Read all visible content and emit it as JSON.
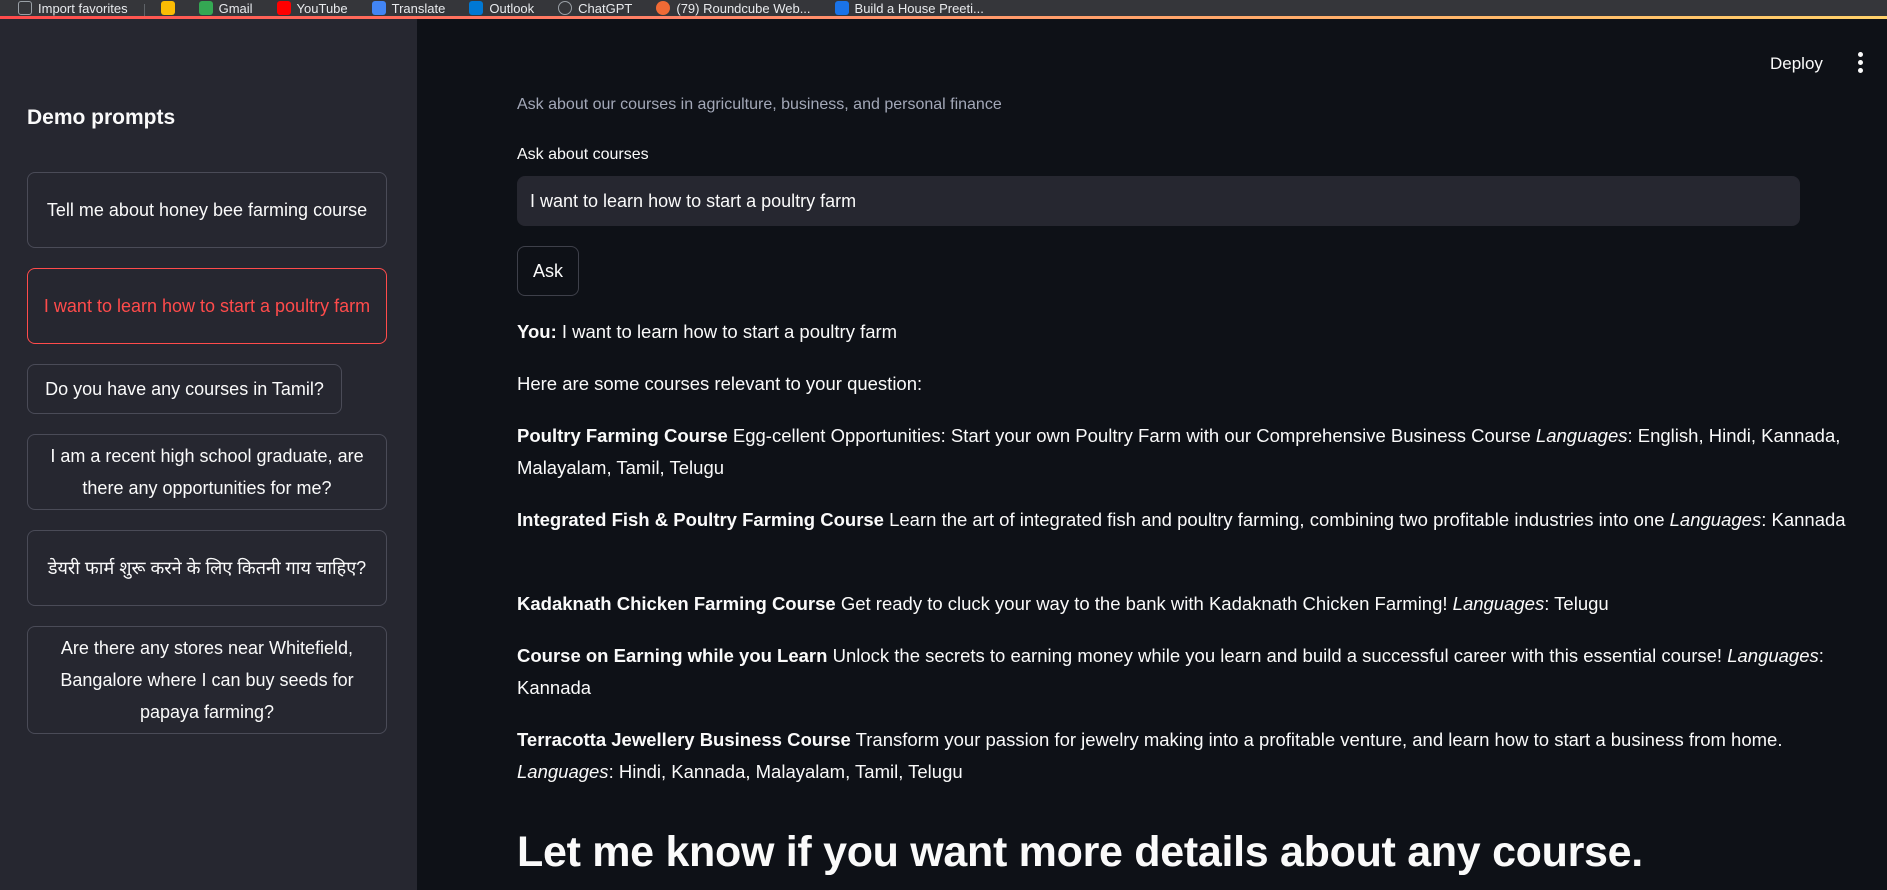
{
  "browser": {
    "bookmarks": [
      {
        "label": "Import favorites",
        "color": "#9aa0a6"
      },
      {
        "label": "",
        "color": "#fbbc04"
      },
      {
        "label": "Gmail",
        "color": "#34a853"
      },
      {
        "label": "YouTube",
        "color": "#ff0000"
      },
      {
        "label": "Translate",
        "color": "#4285f4"
      },
      {
        "label": "Outlook",
        "color": "#0078d4"
      },
      {
        "label": "ChatGPT",
        "color": "#9aa0a6"
      },
      {
        "label": "(79) Roundcube Web...",
        "color": "#f06a35"
      },
      {
        "label": "Build a House Preeti...",
        "color": "#1a73e8"
      }
    ]
  },
  "sidebar": {
    "title": "Demo prompts",
    "prompts": [
      {
        "label": "Tell me about honey bee farming course",
        "active": false
      },
      {
        "label": "I want to learn how to start a poultry farm",
        "active": true
      },
      {
        "label": "Do you have any courses in Tamil?",
        "active": false
      },
      {
        "label": "I am a recent high school graduate, are there any opportunities for me?",
        "active": false
      },
      {
        "label": "डेयरी फार्म शुरू करने के लिए कितनी गाय चाहिए?",
        "active": false
      },
      {
        "label": "Are there any stores near Whitefield, Bangalore where I can buy seeds for papaya farming?",
        "active": false
      }
    ]
  },
  "header": {
    "deploy_label": "Deploy"
  },
  "main": {
    "caption": "Ask about our courses in agriculture, business, and personal finance",
    "input_label": "Ask about courses",
    "input_value": "I want to learn how to start a poultry farm",
    "ask_label": "Ask",
    "you_label": "You:",
    "you_message": " I want to learn how to start a poultry farm",
    "intro": "Here are some courses relevant to your question:",
    "languages_label": "Languages",
    "courses": [
      {
        "name": "Poultry Farming Course",
        "description": " Egg-cellent Opportunities: Start your own Poultry Farm with our Comprehensive Business Course ",
        "languages": ": English, Hindi, Kannada, Malayalam, Tamil, Telugu"
      },
      {
        "name": "Integrated Fish & Poultry Farming Course",
        "description": " Learn the art of integrated fish and poultry farming, combining two profitable industries into one ",
        "languages": ": Kannada"
      },
      {
        "name": "Kadaknath Chicken Farming Course",
        "description": " Get ready to cluck your way to the bank with Kadaknath Chicken Farming! ",
        "languages": ": Telugu"
      },
      {
        "name": "Course on Earning while you Learn",
        "description": " Unlock the secrets to earning money while you learn and build a successful career with this essential course! ",
        "languages": ": Kannada"
      },
      {
        "name": "Terracotta Jewellery Business Course",
        "description": " Transform your passion for jewelry making into a profitable venture, and learn how to start a business from home. ",
        "languages": ": Hindi, Kannada, Malayalam, Tamil, Telugu"
      }
    ],
    "closing": "Let me know if you want more details about any course."
  }
}
